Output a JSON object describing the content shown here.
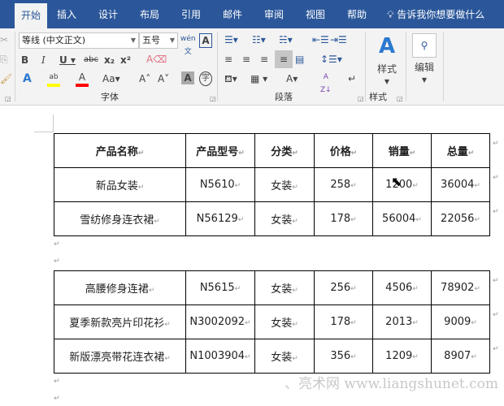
{
  "tabs": [
    "开始",
    "插入",
    "设计",
    "布局",
    "引用",
    "邮件",
    "审阅",
    "视图",
    "帮助"
  ],
  "active_tab": "开始",
  "tell_me": "告诉我你想要做什么",
  "font": {
    "name": "等线 (中文正文)",
    "size": "五号",
    "group_label": "字体"
  },
  "paragraph": {
    "group_label": "段落"
  },
  "styles": {
    "button_label": "样式",
    "group_label": "样式"
  },
  "editing": {
    "button_label": "编辑"
  },
  "colors": {
    "ribbon_blue": "#2b579a",
    "highlight": "#ffff00",
    "font_color": "#ff0000"
  },
  "table1": {
    "headers": [
      "产品名称",
      "产品型号",
      "分类",
      "价格",
      "销量",
      "总量"
    ],
    "rows": [
      [
        "新品女装",
        "N5610",
        "女装",
        "258",
        "1200",
        "36004"
      ],
      [
        "雪纺修身连衣裙",
        "N56129",
        "女装",
        "178",
        "56004",
        "22056"
      ]
    ]
  },
  "table2": {
    "rows": [
      [
        "高腰修身连裙",
        "N5615",
        "女装",
        "256",
        "4506",
        "78902"
      ],
      [
        "夏季新款亮片印花衫",
        "N3002092",
        "女装",
        "178",
        "2013",
        "9009"
      ],
      [
        "新版漂亮带花连衣裙",
        "N1003904",
        "女装",
        "356",
        "1209",
        "8907"
      ]
    ]
  },
  "paragraph_mark": "↵",
  "watermark": "、亮术网 www.liangshunet.com"
}
